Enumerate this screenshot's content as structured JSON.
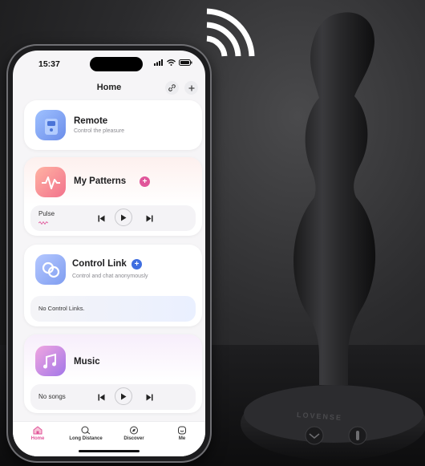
{
  "status": {
    "time": "15:37"
  },
  "header": {
    "title": "Home",
    "link_icon": "link-icon",
    "add_icon": "plus-icon"
  },
  "cards": {
    "remote": {
      "title": "Remote",
      "subtitle": "Control the pleasure"
    },
    "patterns": {
      "title": "My Patterns",
      "track": "Pulse"
    },
    "control_link": {
      "title": "Control Link",
      "subtitle": "Control and chat anonymously",
      "empty": "No Control Links."
    },
    "music": {
      "title": "Music",
      "track": "No songs"
    }
  },
  "tabs": [
    {
      "label": "Home",
      "active": true
    },
    {
      "label": "Long Distance"
    },
    {
      "label": "Discover"
    },
    {
      "label": "Me"
    }
  ],
  "product": {
    "brand": "LOVENSE"
  },
  "colors": {
    "accent": "#e0559a",
    "blue_accent": "#3f6ee0",
    "tab_active": "#e0559a"
  }
}
